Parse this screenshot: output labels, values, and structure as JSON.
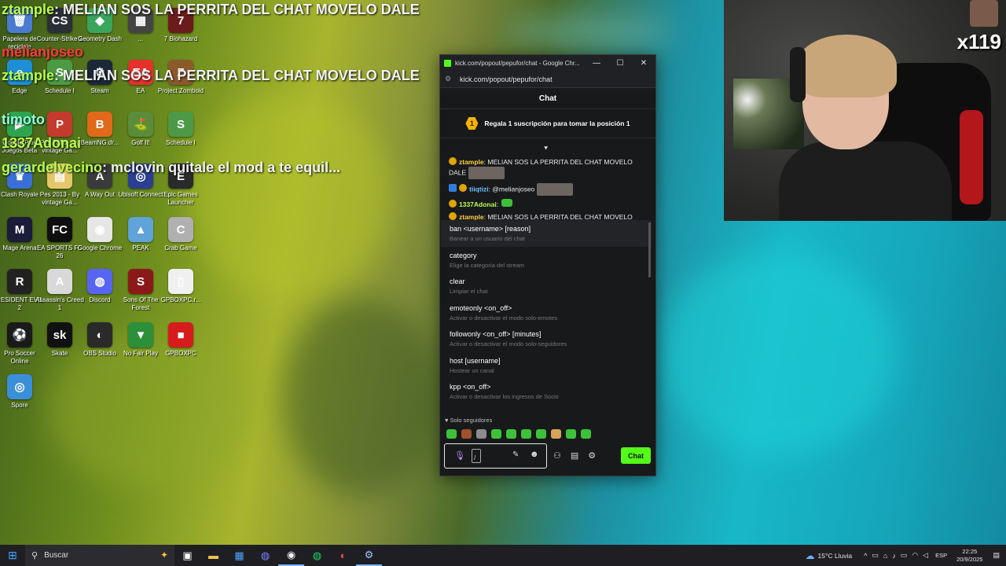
{
  "overlay_chat": [
    {
      "user": "ztample",
      "text": ": MELIAN SOS LA PERRITA DEL CHAT MOVELO DALE"
    },
    {
      "user": "melianjoseo",
      "text": ""
    },
    {
      "user": "ztample",
      "text": ": MELIAN SOS LA PERRITA DEL CHAT MOVELO DALE"
    },
    {
      "user": "timoto",
      "text": ""
    },
    {
      "user": "1337Adonai",
      "text": ""
    },
    {
      "user": "gerardelvecino",
      "text": ": mclovin quitale el mod a te equil... "
    }
  ],
  "desktop_icons": [
    {
      "label": "Papelera de reciclaje",
      "color": "#4a7bd0",
      "glyph": "🗑"
    },
    {
      "label": "Counter-Strike 2",
      "color": "#2b2f36",
      "glyph": "CS"
    },
    {
      "label": "Geometry Dash",
      "color": "#3aa55c",
      "glyph": "◆"
    },
    {
      "label": "...",
      "color": "#444",
      "glyph": "▦"
    },
    {
      "label": "7 Biohazard",
      "color": "#6a1c1c",
      "glyph": "7"
    },
    {
      "label": "Edge",
      "color": "#1c8fd6",
      "glyph": "e"
    },
    {
      "label": "Schedule I",
      "color": "#4c9a46",
      "glyph": "S"
    },
    {
      "label": "Steam",
      "color": "#1b2838",
      "glyph": "⚙"
    },
    {
      "label": "EA",
      "color": "#e4312b",
      "glyph": "EA"
    },
    {
      "label": "Project Zomboid",
      "color": "#8b5a2b",
      "glyph": "Z"
    },
    {
      "label": "Google Play Juegos Beta",
      "color": "#2ea44f",
      "glyph": "▶"
    },
    {
      "label": "Pes 2013 - By vintage Ga...",
      "color": "#c43b2d",
      "glyph": "P"
    },
    {
      "label": "BeamNG.dr...",
      "color": "#e06a1a",
      "glyph": "B"
    },
    {
      "label": "Golf It!",
      "color": "#5a8c3a",
      "glyph": "⛳"
    },
    {
      "label": "Schedule I",
      "color": "#4c9a46",
      "glyph": "S"
    },
    {
      "label": "Clash Royale",
      "color": "#3a6fd8",
      "glyph": "♛"
    },
    {
      "label": "Pes 2013 - By vintage Ga...",
      "color": "#e5c76b",
      "glyph": "▤"
    },
    {
      "label": "A Way Out",
      "color": "#3a3a3a",
      "glyph": "A"
    },
    {
      "label": "Ubisoft Connect",
      "color": "#2a3f8f",
      "glyph": "◎"
    },
    {
      "label": "Epic Games Launcher",
      "color": "#2a2a2a",
      "glyph": "E"
    },
    {
      "label": "Mage Arena",
      "color": "#1b1b3a",
      "glyph": "M"
    },
    {
      "label": "EA SPORTS FC 26",
      "color": "#0f0f0f",
      "glyph": "FC"
    },
    {
      "label": "Google Chrome",
      "color": "#e6e6e6",
      "glyph": "◉"
    },
    {
      "label": "PEAK",
      "color": "#5fa3d8",
      "glyph": "▲"
    },
    {
      "label": "Crab Game",
      "color": "#b0b0b0",
      "glyph": "C"
    },
    {
      "label": "RESIDENT EVIL 2",
      "color": "#222",
      "glyph": "R"
    },
    {
      "label": "Assassin's Creed 1",
      "color": "#d9d9d9",
      "glyph": "A"
    },
    {
      "label": "Discord",
      "color": "#5865f2",
      "glyph": "◍"
    },
    {
      "label": "Sons Of The Forest",
      "color": "#8a1a1a",
      "glyph": "S"
    },
    {
      "label": "GPBOXPC.r...",
      "color": "#f0f0f0",
      "glyph": "▯"
    },
    {
      "label": "Pro Soccer Online",
      "color": "#1a1a1a",
      "glyph": "⚽"
    },
    {
      "label": "Skate",
      "color": "#111",
      "glyph": "sk"
    },
    {
      "label": "OBS Studio",
      "color": "#2a2a2a",
      "glyph": "◐"
    },
    {
      "label": "No Fair Play",
      "color": "#2c8f3a",
      "glyph": "▼"
    },
    {
      "label": "GPBOXPC",
      "color": "#d61c1c",
      "glyph": "■"
    },
    {
      "label": "Spore",
      "color": "#3a8fd8",
      "glyph": "◎"
    }
  ],
  "webcam": {
    "counter": "x119"
  },
  "window": {
    "title": "kick.com/popout/pepufor/chat - Google Chr...",
    "url": "kick.com/popout/pepufor/chat",
    "minimize": "—",
    "maximize": "☐",
    "close": "✕"
  },
  "chat": {
    "header": "Chat",
    "promo_number": "1",
    "promo_text": "Regala 1 suscripción para tomar la posición 1",
    "messages": [
      {
        "user": "ztample",
        "text": ": MELIAN SOS LA PERRITA DEL CHAT MOVELO DALE"
      },
      {
        "user": "tiiqtizi",
        "text": ": @melianjoseo"
      },
      {
        "user": "1337Adonai",
        "text": ":"
      },
      {
        "user": "ztample",
        "text": ": MELIAN SOS LA PERRITA DEL CHAT MOVELO"
      }
    ],
    "commands": [
      {
        "name": "ban <username> [reason]",
        "desc": "Banear a un usuario del chat"
      },
      {
        "name": "category",
        "desc": "Elige la categoría del stream"
      },
      {
        "name": "clear",
        "desc": "Limpiar el chat"
      },
      {
        "name": "emoteonly <on_off>",
        "desc": "Activar o desactivar el modo solo-emotes"
      },
      {
        "name": "followonly <on_off> [minutes]",
        "desc": "Activar o desactivar el modo solo-seguidores"
      },
      {
        "name": "host [username]",
        "desc": "Hostear un canal"
      },
      {
        "name": "kpp <on_off>",
        "desc": "Activar o desactivar los ingresos de Socio"
      }
    ],
    "mode_label": "Solo seguidores",
    "input_value": "/",
    "send_label": "Chat"
  },
  "taskbar": {
    "search_label": "Buscar",
    "weather": "15°C Lluvia",
    "lang": "ESP",
    "time": "22:25",
    "date": "20/9/2025"
  },
  "colors": {
    "kick_green": "#53fc18",
    "chat_bg": "#18191b"
  }
}
